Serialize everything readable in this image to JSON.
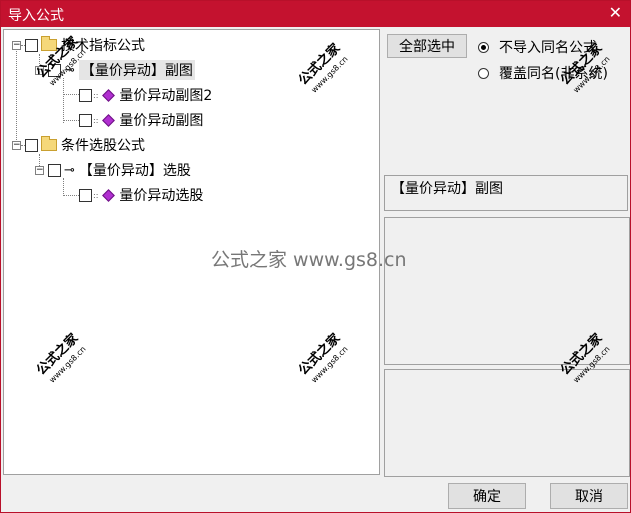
{
  "window": {
    "title": "导入公式",
    "close_glyph": "✕"
  },
  "tree": {
    "nodes": [
      {
        "label": "技术指标公式"
      },
      {
        "label": "【量价异动】副图"
      },
      {
        "label": "量价异动副图2"
      },
      {
        "label": "量价异动副图"
      },
      {
        "label": "条件选股公式"
      },
      {
        "label": "【量价异动】选股"
      },
      {
        "label": "量价异动选股"
      }
    ],
    "expander_glyph": "−"
  },
  "options": {
    "select_all_label": "全部选中",
    "radio_skip_label": "不导入同名公式",
    "radio_overwrite_label": "覆盖同名(非系统)",
    "selected_radio": "skip"
  },
  "detail": {
    "formula_name": "【量价异动】副图"
  },
  "footer": {
    "ok_label": "确定",
    "cancel_label": "取消"
  },
  "watermark": {
    "brand": "公式之家",
    "url": "www.gs8.cn",
    "center_text": "公式之家 www.gs8.cn"
  },
  "colors": {
    "titlebar": "#c4122f",
    "gem": "#b02fd0",
    "folder": "#f5d87a"
  }
}
